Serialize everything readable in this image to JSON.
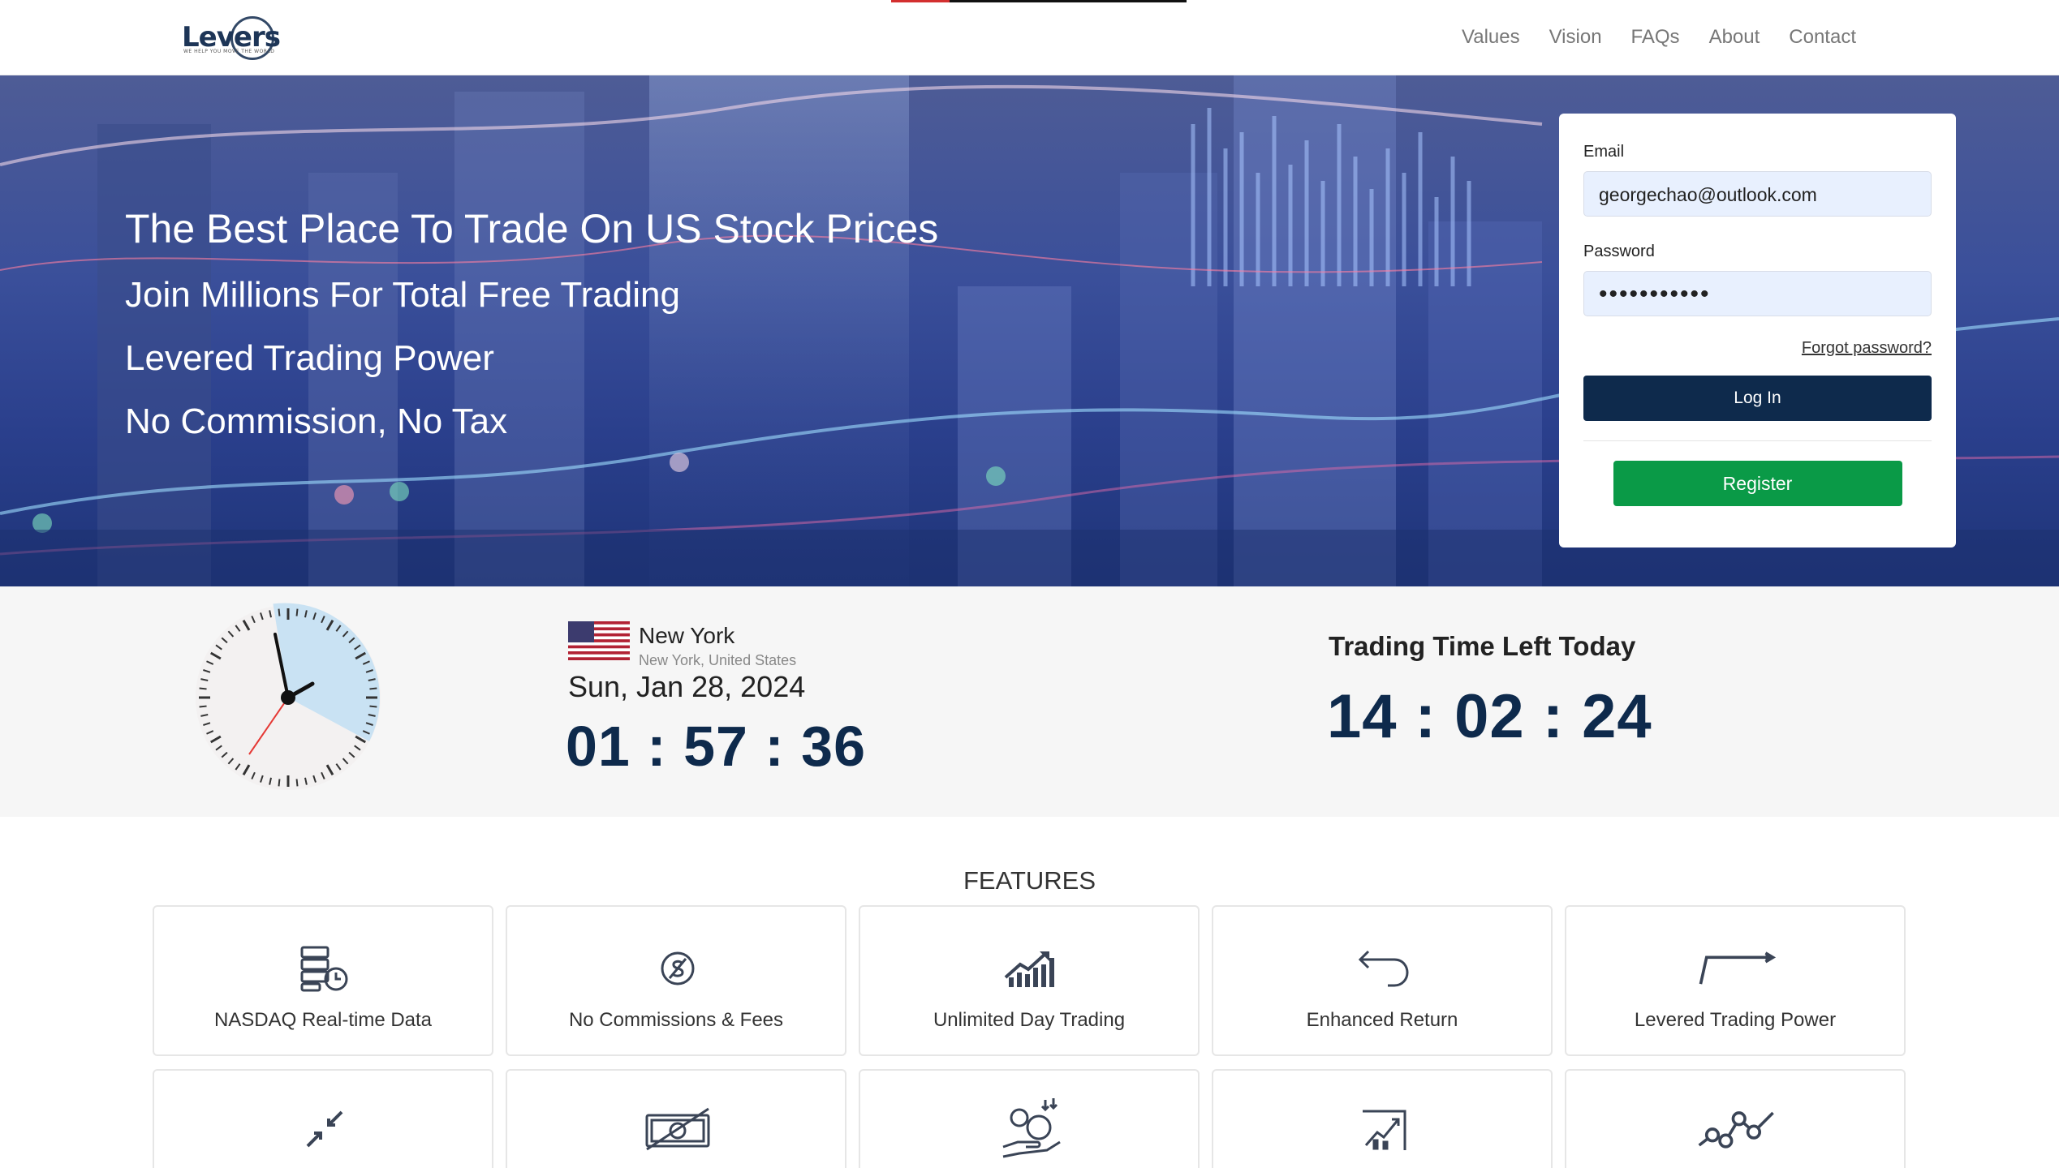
{
  "nav": {
    "logo_text": "Levers",
    "logo_tagline": "WE HELP YOU MOVE THE WORLD",
    "links": [
      "Values",
      "Vision",
      "FAQs",
      "About",
      "Contact"
    ]
  },
  "hero": {
    "headline": "The Best Place To Trade On US Stock Prices",
    "lines": [
      "Join Millions For Total Free Trading",
      "Levered Trading Power",
      "No Commission, No Tax"
    ]
  },
  "login": {
    "email_label": "Email",
    "email_value": "georgechao@outlook.com",
    "password_label": "Password",
    "password_value": "•••••••••••",
    "forgot_label": "Forgot password?",
    "login_label": "Log In",
    "register_label": "Register"
  },
  "clock": {
    "city": "New York",
    "region": "New York, United States",
    "date": "Sun, Jan 28, 2024",
    "time": "01 : 57 : 36",
    "trading_title": "Trading Time Left Today",
    "trading_time": "14 : 02 : 24"
  },
  "features": {
    "title": "FEATURES",
    "items": [
      {
        "label": "NASDAQ Real-time Data",
        "icon": "database-clock-icon"
      },
      {
        "label": "No Commissions & Fees",
        "icon": "no-dollar-icon"
      },
      {
        "label": "Unlimited Day Trading",
        "icon": "bar-chart-up-icon"
      },
      {
        "label": "Enhanced Return",
        "icon": "return-arrow-icon"
      },
      {
        "label": "Levered Trading Power",
        "icon": "lever-arrow-icon"
      }
    ],
    "row2_icons": [
      "compress-arrows-icon",
      "no-cash-icon",
      "money-hand-icon",
      "chart-growth-icon",
      "trend-nodes-icon"
    ]
  },
  "colors": {
    "navy": "#0e2a4c",
    "green": "#0a9a47",
    "hero_blue": "#2a3f8c"
  }
}
